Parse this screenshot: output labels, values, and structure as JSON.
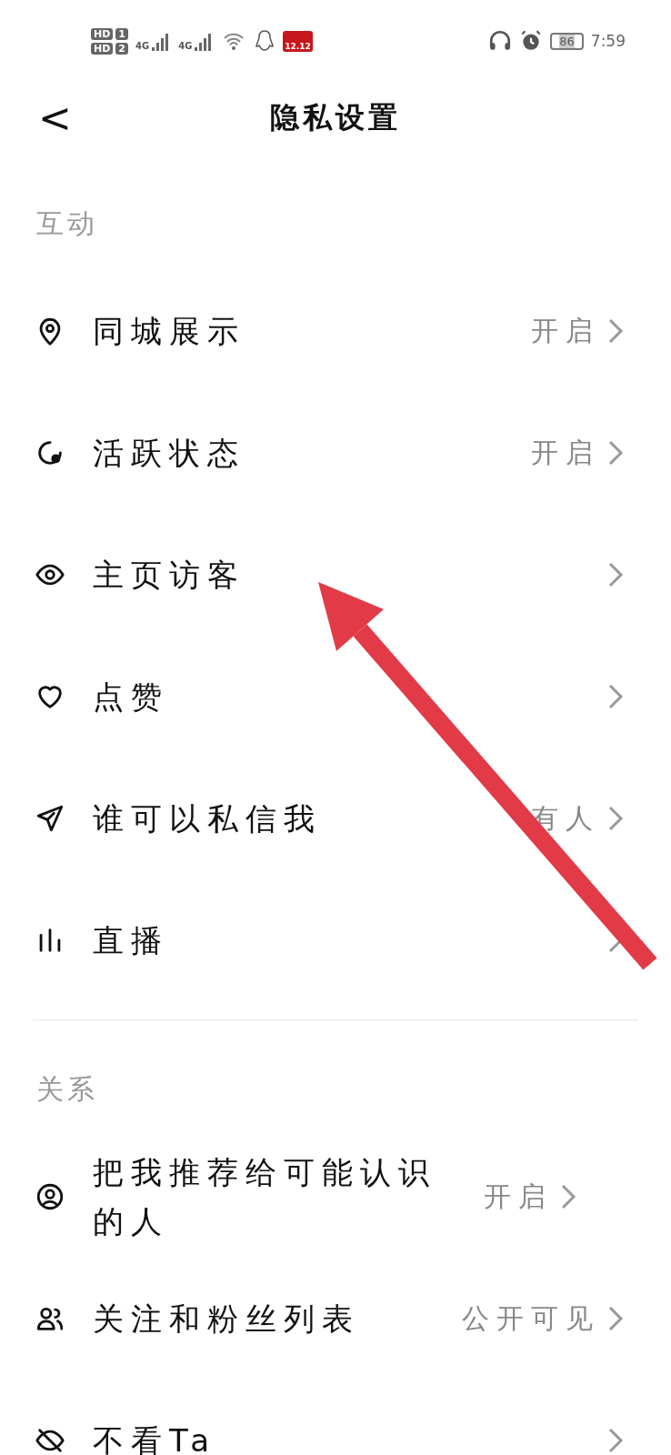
{
  "status_bar": {
    "sims": [
      {
        "label": "HD",
        "slot": "1"
      },
      {
        "label": "HD",
        "slot": "2"
      }
    ],
    "networks": [
      "4G",
      "4G"
    ],
    "app_badge": "12.12",
    "battery": "86",
    "time": "7:59"
  },
  "header": {
    "back": "<",
    "title": "隐私设置"
  },
  "sections": [
    {
      "title": "互动",
      "rows": [
        {
          "label": "同城展示",
          "value": "开启"
        },
        {
          "label": "活跃状态",
          "value": "开启"
        },
        {
          "label": "主页访客"
        },
        {
          "label": "点赞"
        },
        {
          "label": "谁可以私信我",
          "value": "有人"
        },
        {
          "label": "直播"
        }
      ]
    },
    {
      "title": "关系",
      "rows": [
        {
          "label": "把我推荐给可能认识的人",
          "value": "开启"
        },
        {
          "label": "关注和粉丝列表",
          "value": "公开可见"
        },
        {
          "label": "不看Ta"
        }
      ]
    }
  ]
}
